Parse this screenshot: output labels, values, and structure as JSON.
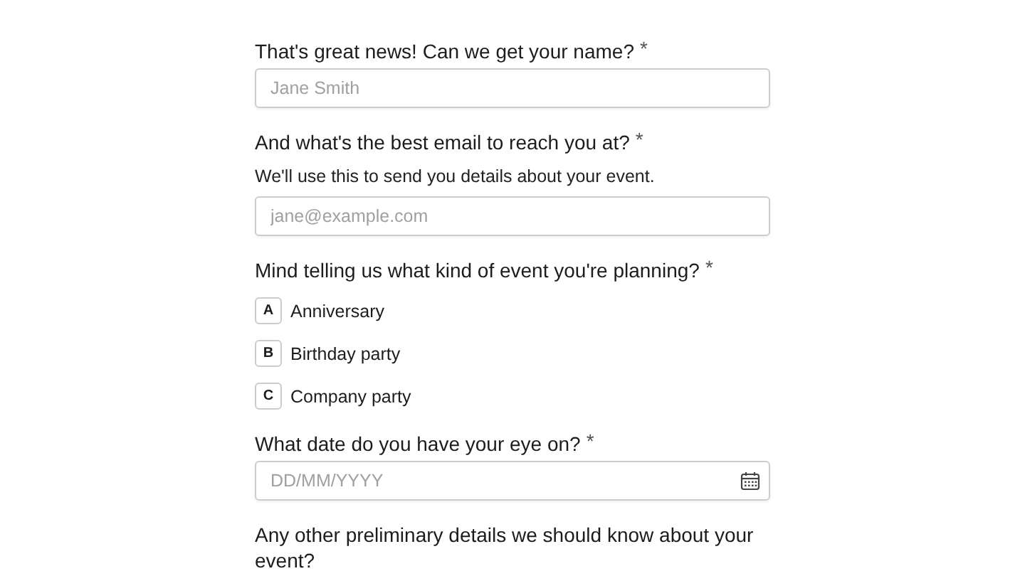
{
  "questions": [
    {
      "kind": "text",
      "label": "That's great news! Can we get your name?",
      "required_mark": "*",
      "placeholder": "Jane Smith"
    },
    {
      "kind": "text",
      "label": "And what's the best email to reach you at?",
      "required_mark": "*",
      "help": "We'll use this to send you details about your event.",
      "placeholder": "jane@example.com"
    },
    {
      "kind": "choice",
      "label": "Mind telling us what kind of event you're planning?",
      "required_mark": "*",
      "options": [
        {
          "key": "A",
          "label": "Anniversary",
          "selected": false
        },
        {
          "key": "B",
          "label": "Birthday party",
          "selected": false
        },
        {
          "key": "C",
          "label": "Company party",
          "selected": false
        }
      ]
    },
    {
      "kind": "date",
      "label": "What date do you have your eye on?",
      "required_mark": "*",
      "placeholder": "DD/MM/YYYY"
    },
    {
      "kind": "heading",
      "label": "Any other preliminary details we should know about your event?"
    }
  ]
}
